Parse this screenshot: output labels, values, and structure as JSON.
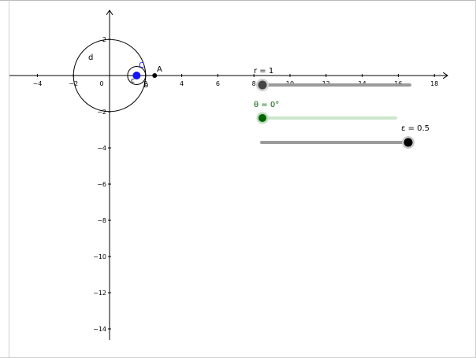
{
  "graphics": {
    "x_ticks": [
      "−4",
      "−2",
      "0",
      "2",
      "4",
      "6",
      "8",
      "10",
      "12",
      "14",
      "16",
      "18"
    ],
    "y_ticks_pos": [
      "2"
    ],
    "y_ticks_neg": [
      "−2",
      "−4",
      "−6",
      "−8",
      "−10",
      "−12",
      "−14"
    ],
    "x_tick_values": [
      -4,
      -2,
      0,
      2,
      4,
      6,
      8,
      10,
      12,
      14,
      16,
      18
    ],
    "y_tick_values": [
      2,
      -2,
      -4,
      -6,
      -8,
      -10,
      -12,
      -14
    ],
    "circle_d": {
      "label": "d",
      "center": [
        0,
        0
      ],
      "radius": 2
    },
    "circle_c": {
      "label": "c",
      "center": [
        1.5,
        0
      ],
      "radius": 0.5
    },
    "point_C": {
      "label": "C",
      "x": 1.5,
      "y": 0,
      "color": "#1414ff"
    },
    "point_A": {
      "label": "A",
      "x": 2.5,
      "y": 0,
      "color": "#000000"
    },
    "point_b": {
      "label": "b"
    }
  },
  "sliders": {
    "r": {
      "label": "r = 1",
      "color": "#444444",
      "track_color": "#9a9a9a"
    },
    "theta": {
      "label": "θ = 0°",
      "color": "#006400",
      "track_color": "#cce6cc"
    },
    "epsilon": {
      "label": "ε = 0.5",
      "color": "#000000",
      "track_color": "#9a9a9a"
    }
  }
}
